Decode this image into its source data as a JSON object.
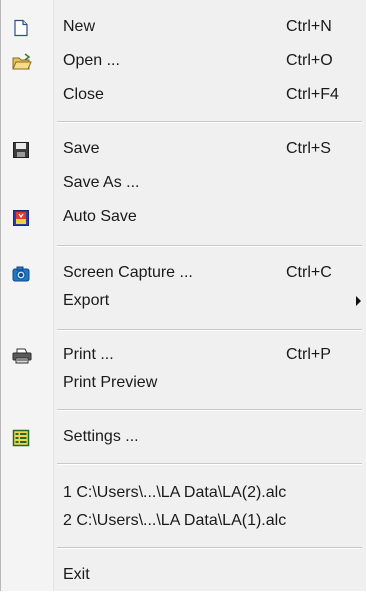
{
  "menu": {
    "new": {
      "label": "New",
      "shortcut": "Ctrl+N"
    },
    "open": {
      "label": "Open ...",
      "shortcut": "Ctrl+O"
    },
    "close": {
      "label": "Close",
      "shortcut": "Ctrl+F4"
    },
    "save": {
      "label": "Save",
      "shortcut": "Ctrl+S"
    },
    "save_as": {
      "label": "Save As ..."
    },
    "auto_save": {
      "label": "Auto Save"
    },
    "screen_capture": {
      "label": "Screen Capture ...",
      "shortcut": "Ctrl+C"
    },
    "export": {
      "label": "Export"
    },
    "print": {
      "label": "Print ...",
      "shortcut": "Ctrl+P"
    },
    "print_preview": {
      "label": "Print Preview"
    },
    "settings": {
      "label": "Settings ..."
    },
    "recent": [
      {
        "label": "1 C:\\Users\\...\\LA Data\\LA(2).alc"
      },
      {
        "label": "2 C:\\Users\\...\\LA Data\\LA(1).alc"
      }
    ],
    "exit": {
      "label": "Exit"
    }
  },
  "icons": {
    "new": "document-icon",
    "open": "folder-open-icon",
    "save": "floppy-disk-icon",
    "auto_save": "auto-save-icon",
    "screen_capture": "camera-icon",
    "print": "printer-icon",
    "settings": "settings-list-icon"
  }
}
